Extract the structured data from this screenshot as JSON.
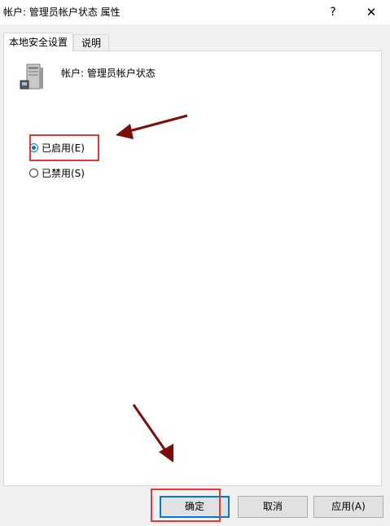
{
  "window": {
    "title": "帐户: 管理员帐户状态 属性",
    "help_label": "?",
    "close_label": "✕"
  },
  "tabs": [
    {
      "label": "本地安全设置",
      "active": true
    },
    {
      "label": "说明",
      "active": false
    }
  ],
  "setting": {
    "icon": "server-icon",
    "name": "帐户: 管理员帐户状态"
  },
  "options": [
    {
      "label": "已启用(E)",
      "checked": true
    },
    {
      "label": "已禁用(S)",
      "checked": false
    }
  ],
  "buttons": {
    "ok": "确定",
    "cancel": "取消",
    "apply": "应用(A)"
  },
  "colors": {
    "annotation_box": "#e53935",
    "annotation_arrow": "#7b0d0d",
    "focus_accent": "#0078d7"
  }
}
